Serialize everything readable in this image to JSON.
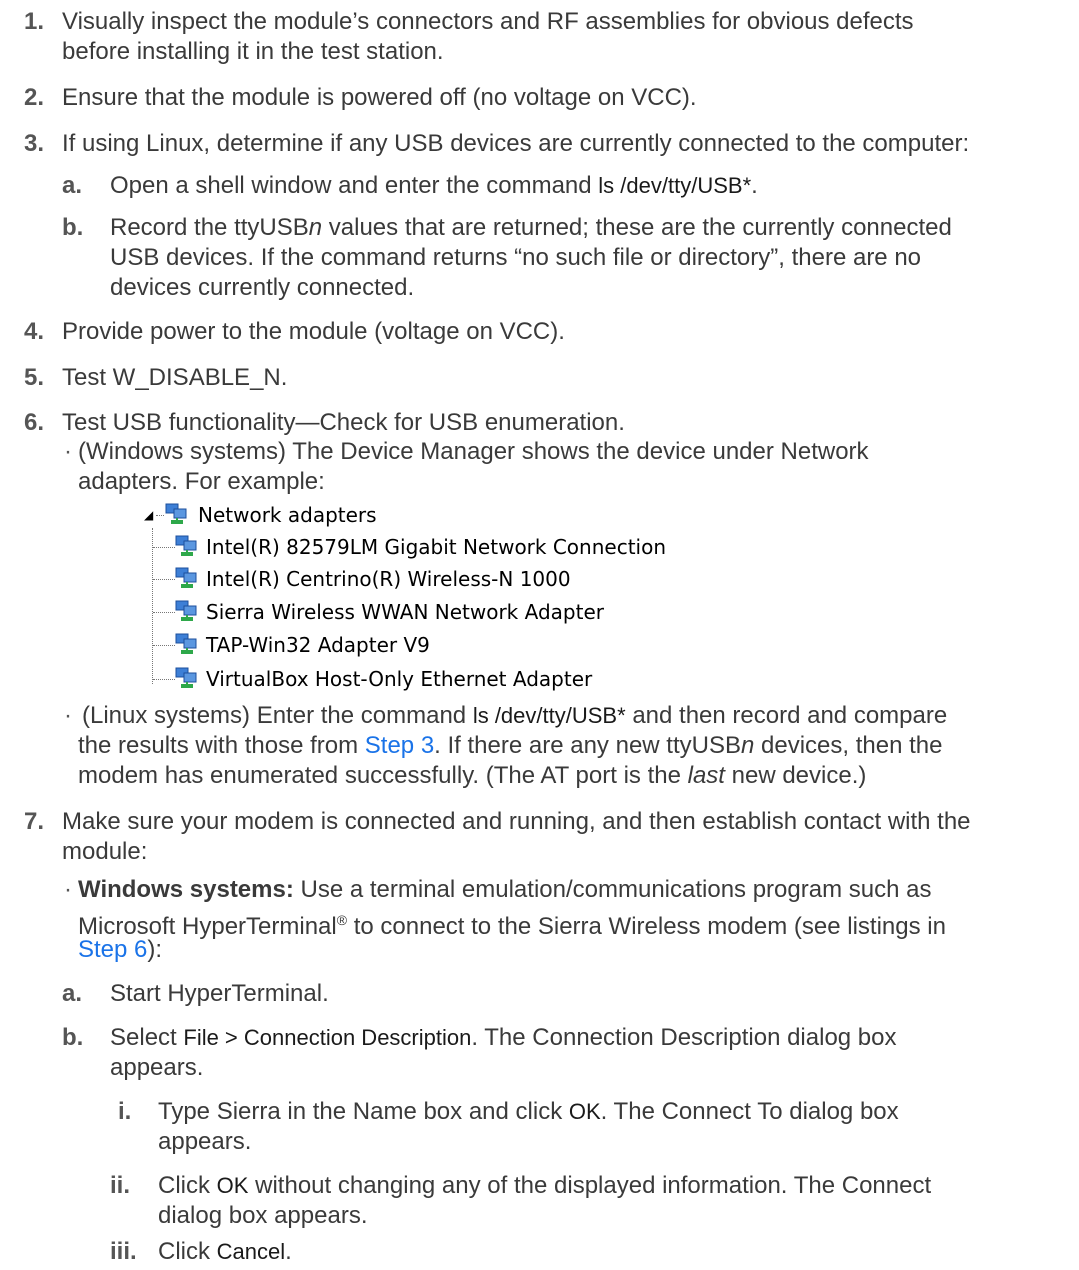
{
  "steps": [
    {
      "num": "1.",
      "text": "Visually inspect the module’s connectors and RF assemblies for obvious defects",
      "text2": "before installing it in the test station."
    },
    {
      "num": "2.",
      "text": "Ensure that the module is powered off (no voltage on VCC)."
    },
    {
      "num": "3.",
      "text": "If using Linux, determine if any USB devices are currently connected to the computer:"
    },
    {
      "num": "4.",
      "text": "Provide power to the module (voltage on VCC)."
    },
    {
      "num": "5.",
      "text": "Test W_DISABLE_N."
    },
    {
      "num": "6.",
      "text": "Test USB functionality—Check for USB enumeration."
    },
    {
      "num": "7.",
      "text": "Make sure your modem is connected and running, and then establish contact with the",
      "text2": "module:"
    }
  ],
  "step3": {
    "a": {
      "label": "a.",
      "pre": "Open a shell window and enter the command ",
      "cmd": "ls /dev/tty/USB*",
      "post": "."
    },
    "b": {
      "label": "b.",
      "l1a": "Record the ttyUSB",
      "l1n": "n",
      "l1b": " values that are returned; these are the currently connected",
      "l2": "USB devices. If the command returns “no such file or directory”, there are no",
      "l3": "devices currently connected."
    }
  },
  "step6": {
    "win_l1": "(Windows systems) The Device Manager shows the device under Network",
    "win_l2": "adapters. For example:",
    "tree": {
      "root": "Network adapters",
      "items": [
        "Intel(R) 82579LM Gigabit Network Connection",
        "Intel(R) Centrino(R) Wireless-N 1000",
        "Sierra Wireless WWAN Network Adapter",
        "TAP-Win32 Adapter V9",
        "VirtualBox Host-Only Ethernet Adapter"
      ]
    },
    "lin": {
      "l1pre": "(Linux systems) Enter the command ",
      "cmd": "ls /dev/tty/USB*",
      "l1post": " and then record and compare",
      "l2pre": "the results with those from ",
      "link": "Step 3",
      "l2mid": ". If there are any new ttyUSB",
      "l2n": "n",
      "l2post": " devices, then the",
      "l3pre": "modem has enumerated successfully. (The AT port is the ",
      "l3em": "last",
      "l3post": " new device.)"
    }
  },
  "step7": {
    "win": {
      "bold": "Windows systems:",
      "l1": " Use a terminal emulation/communications program such as",
      "l2pre": "Microsoft HyperTerminal",
      "reg": "®",
      "l2post": " to connect to the Sierra Wireless modem (see listings in",
      "link": "Step 6",
      "l3post": "):"
    },
    "a": {
      "label": "a.",
      "text": "Start HyperTerminal."
    },
    "b": {
      "label": "b.",
      "pre": "Select ",
      "ui": "File > Connection Description",
      "post": ". The Connection Description dialog box",
      "l2": "appears."
    },
    "i": {
      "label": "i.",
      "pre": "Type Sierra in the Name box and click ",
      "ui": "OK",
      "post": ". The Connect To dialog box",
      "l2": "appears."
    },
    "ii": {
      "label": "ii.",
      "pre": "Click ",
      "ui": "OK",
      "post": " without changing any of the displayed information. The Connect",
      "l2": "dialog box appears."
    },
    "iii": {
      "label": "iii.",
      "pre": "Click ",
      "ui": "Cancel",
      "post": "."
    }
  },
  "colors": {
    "text": "#3a3a3a",
    "link": "#1a73e8",
    "net_icon_blue": "#3d7fd6",
    "net_icon_green": "#2ea84a"
  }
}
